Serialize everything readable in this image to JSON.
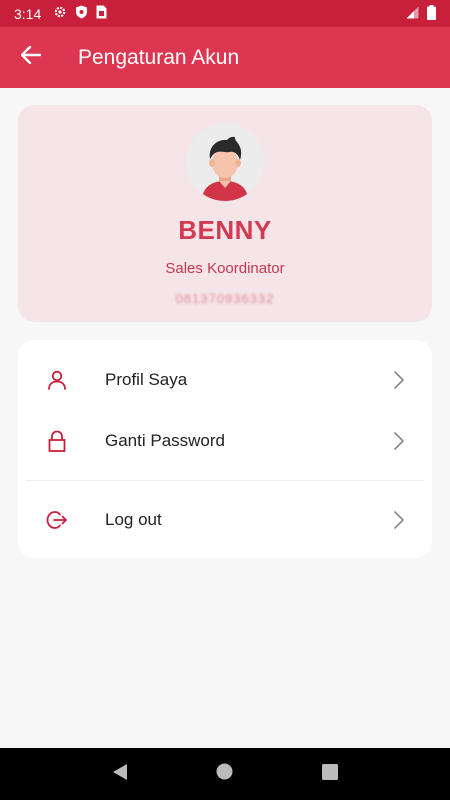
{
  "status_bar": {
    "time": "3:14",
    "icons_left": [
      "gear-icon",
      "shield-icon",
      "sim-card-icon"
    ],
    "icons_right": [
      "signal-icon",
      "battery-icon"
    ]
  },
  "app_bar": {
    "title": "Pengaturan Akun",
    "back_icon": "arrow-left-icon"
  },
  "profile": {
    "name": "BENNY",
    "role": "Sales Koordinator",
    "phone": "081370936332"
  },
  "menu": {
    "items": [
      {
        "label": "Profil Saya",
        "icon": "user-icon"
      },
      {
        "label": "Ganti Password",
        "icon": "lock-icon"
      },
      {
        "label": "Log out",
        "icon": "logout-icon"
      }
    ]
  },
  "colors": {
    "status_bar": "#c8203a",
    "app_bar": "#dc3650",
    "accent": "#d33a51",
    "profile_card": "#f5e5e8",
    "background": "#f7f7f7"
  },
  "nav_bar": {
    "buttons": [
      "back-triangle-icon",
      "home-circle-icon",
      "recents-square-icon"
    ]
  }
}
